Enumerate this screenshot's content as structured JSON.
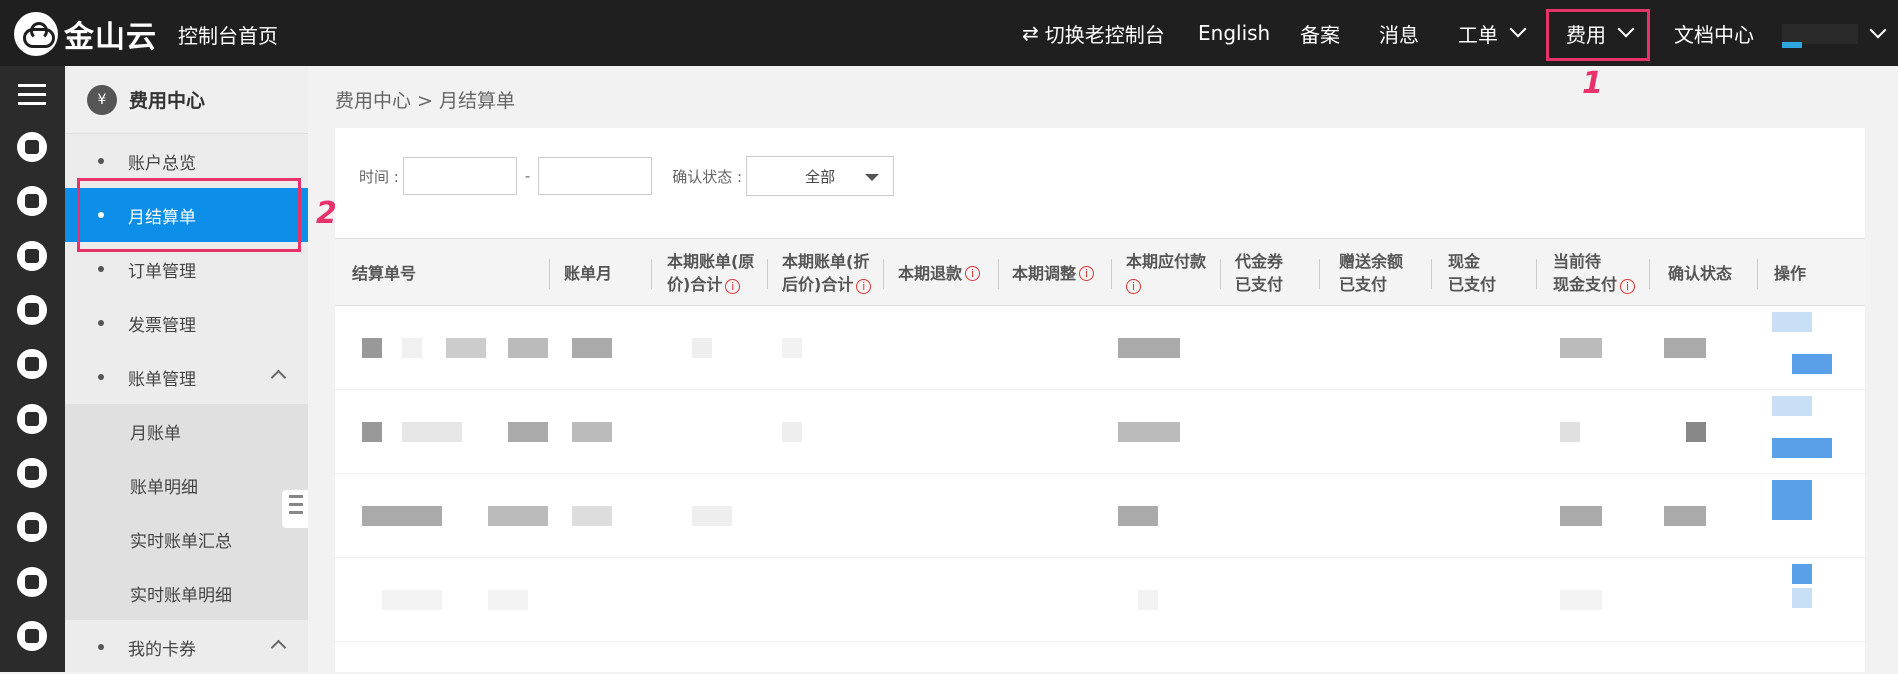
{
  "topbar": {
    "logo_text": "金山云",
    "home_link": "控制台首页",
    "nav": {
      "switch": "切换老控制台",
      "switch_icon": "⇄",
      "english": "English",
      "beian": "备案",
      "messages": "消息",
      "tickets": "工单",
      "fees": "费用",
      "docs": "文档中心"
    }
  },
  "annotations": {
    "one": "1",
    "two": "2"
  },
  "sidebar": {
    "title": "费用中心",
    "title_icon": "¥",
    "items": [
      {
        "label": "账户总览"
      },
      {
        "label": "月结算单"
      },
      {
        "label": "订单管理"
      },
      {
        "label": "发票管理"
      },
      {
        "label": "账单管理"
      },
      {
        "label": "月账单"
      },
      {
        "label": "账单明细"
      },
      {
        "label": "实时账单汇总"
      },
      {
        "label": "实时账单明细"
      },
      {
        "label": "我的卡券"
      }
    ]
  },
  "main": {
    "breadcrumb": "费用中心 > 月结算单",
    "filters": {
      "time_label": "时间 :",
      "dash": "-",
      "status_label": "确认状态 :",
      "status_value": "全部"
    },
    "columns": [
      {
        "line1": "结算单号",
        "line2": ""
      },
      {
        "line1": "账单月",
        "line2": ""
      },
      {
        "line1": "本期账单(原",
        "line2": "价)合计"
      },
      {
        "line1": "本期账单(折",
        "line2": "后价)合计"
      },
      {
        "line1": "本期退款",
        "line2": ""
      },
      {
        "line1": "本期调整",
        "line2": ""
      },
      {
        "line1": "本期应付款",
        "line2": ""
      },
      {
        "line1": "代金券",
        "line2": "已支付"
      },
      {
        "line1": "赠送余额",
        "line2": "已支付"
      },
      {
        "line1": "现金",
        "line2": "已支付"
      },
      {
        "line1": "当前待",
        "line2": "现金支付"
      },
      {
        "line1": "确认状态",
        "line2": ""
      },
      {
        "line1": "操作",
        "line2": ""
      }
    ],
    "info_glyph": "i"
  },
  "colors": {
    "topbar_bg": "#1f1f1f",
    "active_item": "#0d8ee9",
    "annotation": "#e8326b"
  }
}
